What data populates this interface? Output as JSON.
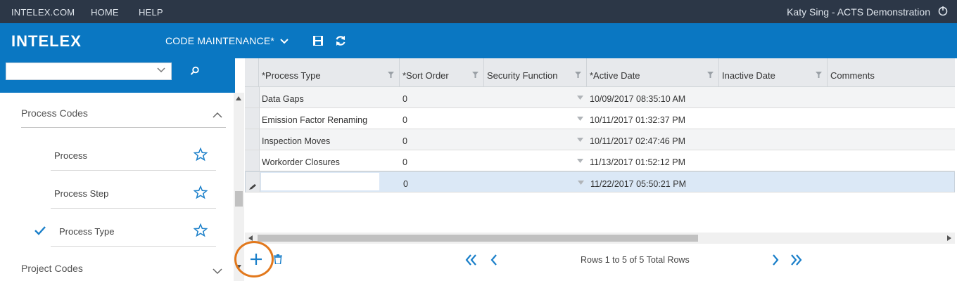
{
  "topbar": {
    "links": [
      "INTELEX.COM",
      "HOME",
      "HELP"
    ],
    "user": "Katy Sing",
    "separator": "-",
    "org": "ACTS Demonstration"
  },
  "header": {
    "logo": "INTELEX",
    "module": "CODE MAINTENANCE*"
  },
  "sidebar": {
    "select_value": "",
    "groups": [
      {
        "label": "Process Codes",
        "expanded": true
      },
      {
        "label": "Project Codes",
        "expanded": false
      }
    ],
    "items": [
      {
        "label": "Process",
        "checked": false
      },
      {
        "label": "Process Step",
        "checked": false
      },
      {
        "label": "Process Type",
        "checked": true
      }
    ]
  },
  "grid": {
    "columns": [
      "*Process Type",
      "*Sort Order",
      "Security Function",
      "*Active Date",
      "Inactive Date",
      "Comments"
    ],
    "rows": [
      {
        "process_type": "Data Gaps",
        "sort_order": "0",
        "security_function": "",
        "active_date": "10/09/2017 08:35:10 AM",
        "inactive_date": "",
        "comments": ""
      },
      {
        "process_type": "Emission Factor Renaming",
        "sort_order": "0",
        "security_function": "",
        "active_date": "10/11/2017 01:32:37 PM",
        "inactive_date": "",
        "comments": ""
      },
      {
        "process_type": "Inspection Moves",
        "sort_order": "0",
        "security_function": "",
        "active_date": "10/11/2017 02:47:46 PM",
        "inactive_date": "",
        "comments": ""
      },
      {
        "process_type": "Workorder Closures",
        "sort_order": "0",
        "security_function": "",
        "active_date": "11/13/2017 01:52:12 PM",
        "inactive_date": "",
        "comments": ""
      },
      {
        "process_type": "",
        "sort_order": "0",
        "security_function": "",
        "active_date": "11/22/2017 05:50:21 PM",
        "inactive_date": "",
        "comments": ""
      }
    ]
  },
  "footer": {
    "rows_info": "Rows 1 to 5 of 5 Total Rows"
  },
  "colors": {
    "topbar": "#2c3747",
    "brand_blue": "#0a77c2",
    "accent_icon": "#1a7fc9",
    "highlight_circle": "#e2781c"
  }
}
